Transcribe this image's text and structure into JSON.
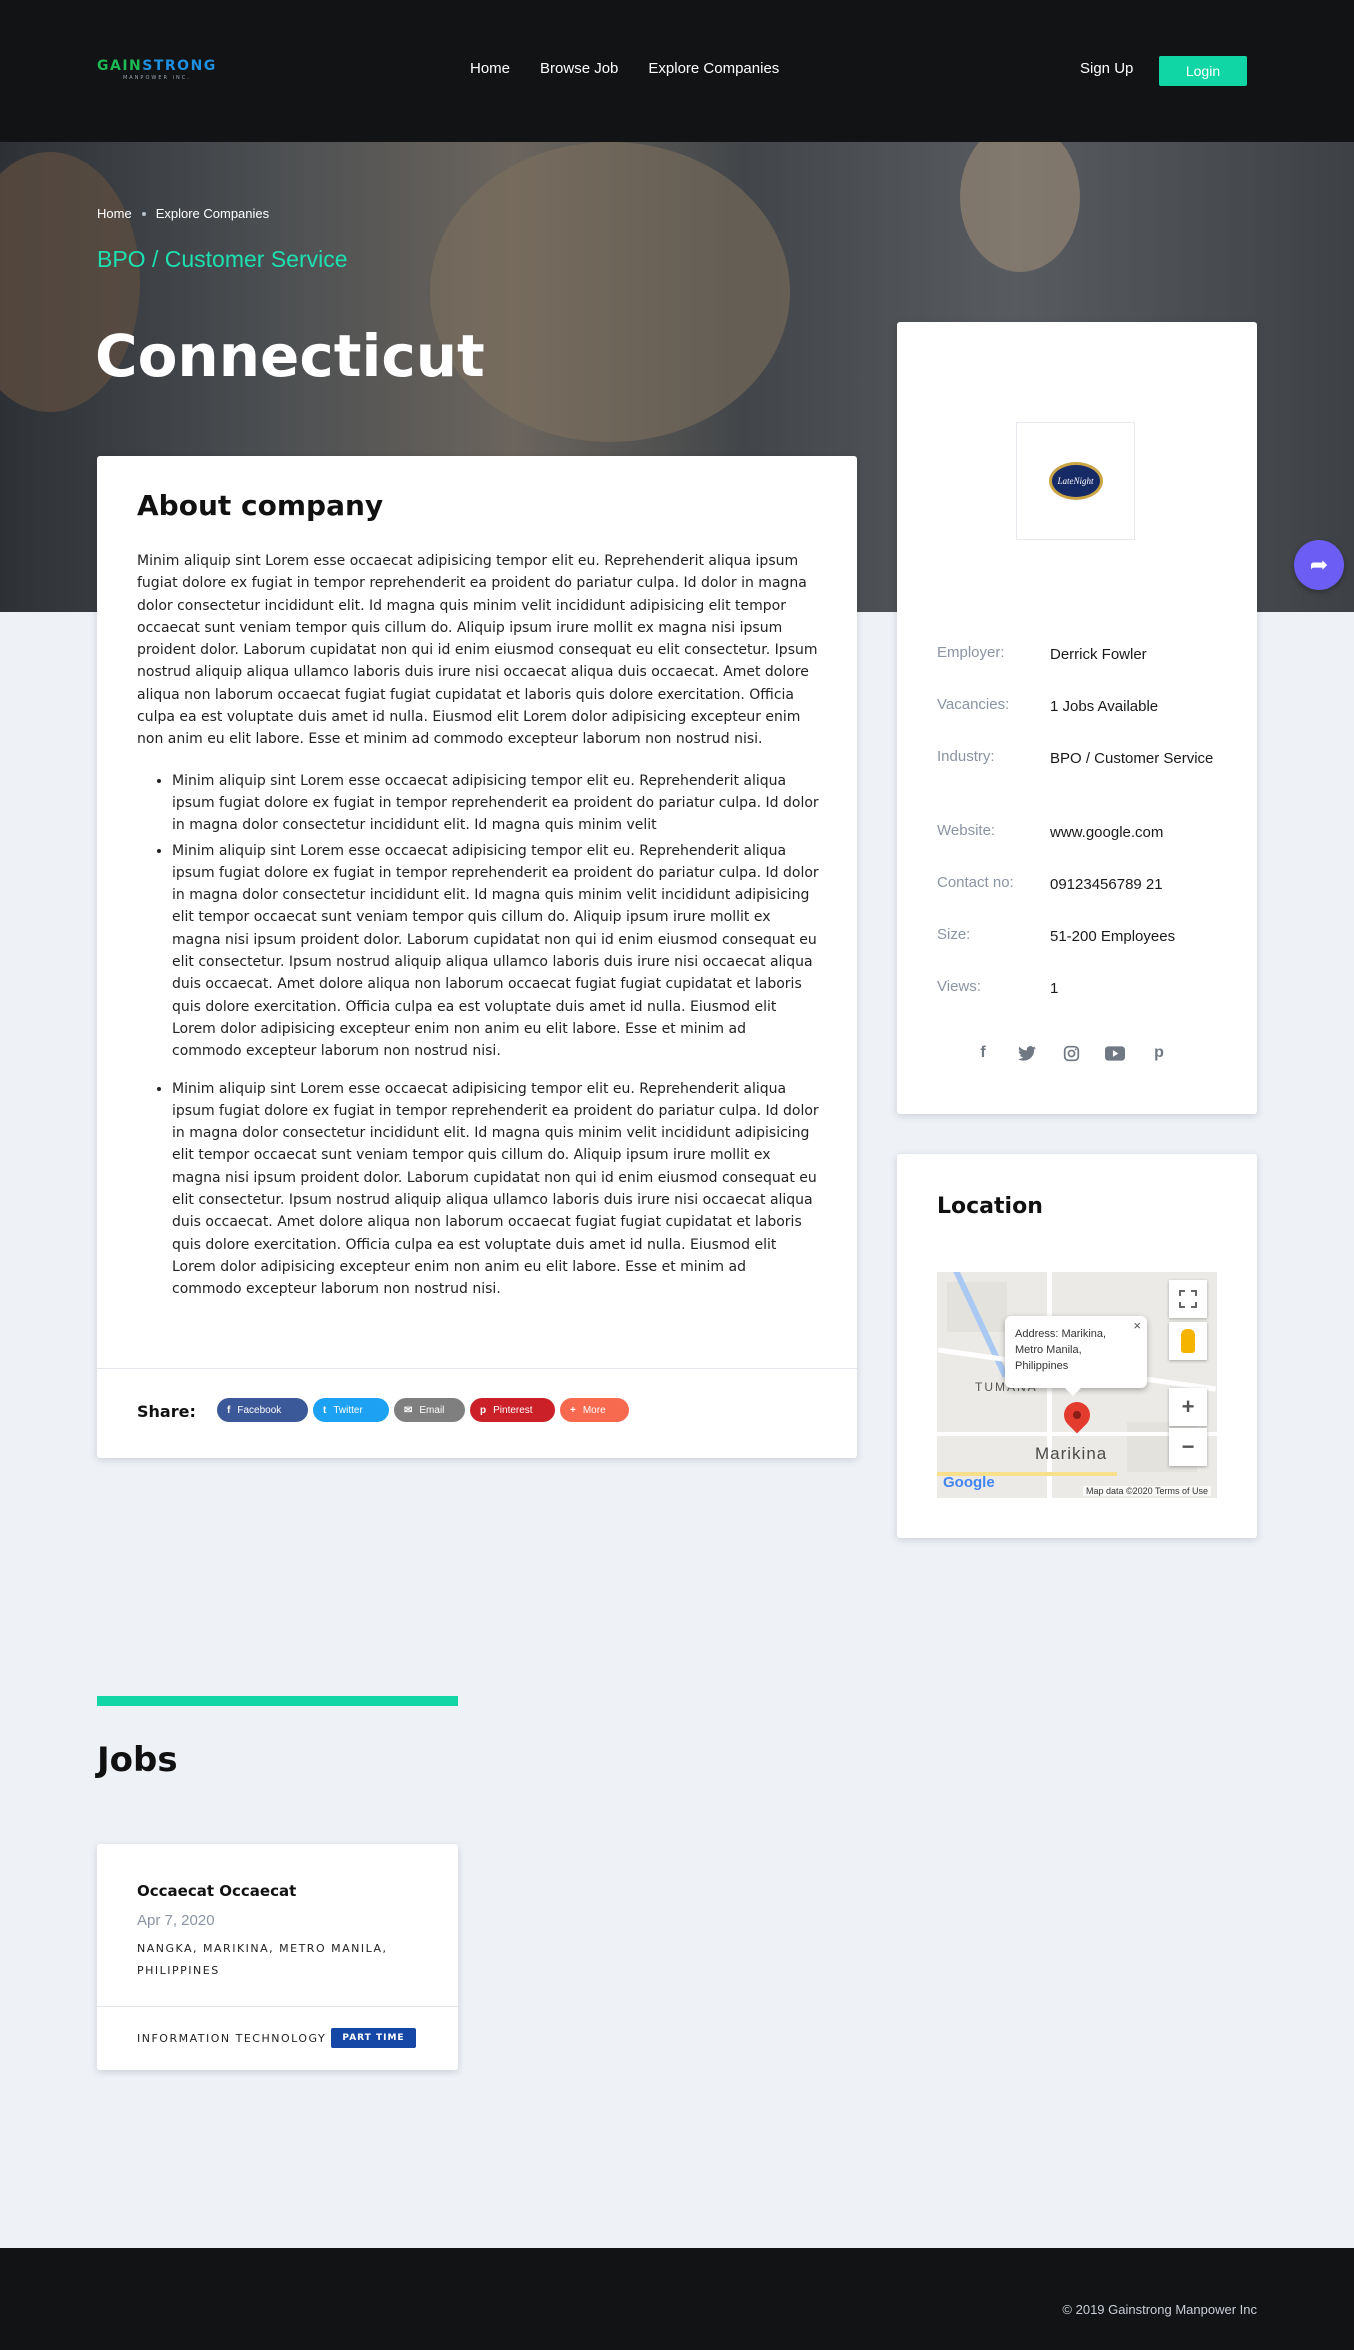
{
  "brand": {
    "logo_part1": "GAIN",
    "logo_part2": "STRONG",
    "logo_sub": "MANPOWER INC."
  },
  "nav": {
    "links": [
      "Home",
      "Browse Job",
      "Explore Companies"
    ],
    "signup": "Sign Up",
    "login": "Login"
  },
  "breadcrumb": [
    "Home",
    "Explore Companies"
  ],
  "hero": {
    "industry": "BPO / Customer Service",
    "company": "Connecticut"
  },
  "about": {
    "title": "About company",
    "paragraph": "Minim aliquip sint Lorem esse occaecat adipisicing tempor elit eu. Reprehenderit aliqua ipsum fugiat dolore ex fugiat in tempor reprehenderit ea proident do pariatur culpa. Id dolor in magna dolor consectetur incididunt elit. Id magna quis minim velit incididunt adipisicing elit tempor occaecat sunt veniam tempor quis cillum do. Aliquip ipsum irure mollit ex magna nisi ipsum proident dolor. Laborum cupidatat non qui id enim eiusmod consequat eu elit consectetur. Ipsum nostrud aliquip aliqua ullamco laboris duis irure nisi occaecat aliqua duis occaecat. Amet dolore aliqua non laborum occaecat fugiat fugiat cupidatat et laboris quis dolore exercitation. Officia culpa ea est voluptate duis amet id nulla. Eiusmod elit Lorem dolor adipisicing excepteur enim non anim eu elit labore. Esse et minim ad commodo excepteur laborum non nostrud nisi.",
    "bullets": [
      "Minim aliquip sint Lorem esse occaecat adipisicing tempor elit eu. Reprehenderit aliqua ipsum fugiat dolore ex fugiat in tempor reprehenderit ea proident do pariatur culpa. Id dolor in magna dolor consectetur incididunt elit. Id magna quis minim velit",
      "Minim aliquip sint Lorem esse occaecat adipisicing tempor elit eu. Reprehenderit aliqua ipsum fugiat dolore ex fugiat in tempor reprehenderit ea proident do pariatur culpa. Id dolor in magna dolor consectetur incididunt elit. Id magna quis minim velit incididunt adipisicing elit tempor occaecat sunt veniam tempor quis cillum do. Aliquip ipsum irure mollit ex magna nisi ipsum proident dolor. Laborum cupidatat non qui id enim eiusmod consequat eu elit consectetur. Ipsum nostrud aliquip aliqua ullamco laboris duis irure nisi occaecat aliqua duis occaecat. Amet dolore aliqua non laborum occaecat fugiat fugiat cupidatat et laboris quis dolore exercitation. Officia culpa ea est voluptate duis amet id nulla. Eiusmod elit Lorem dolor adipisicing excepteur enim non anim eu elit labore. Esse et minim ad commodo excepteur laborum non nostrud nisi.",
      "Minim aliquip sint Lorem esse occaecat adipisicing tempor elit eu. Reprehenderit aliqua ipsum fugiat dolore ex fugiat in tempor reprehenderit ea proident do pariatur culpa. Id dolor in magna dolor consectetur incididunt elit. Id magna quis minim velit incididunt adipisicing elit tempor occaecat sunt veniam tempor quis cillum do. Aliquip ipsum irure mollit ex magna nisi ipsum proident dolor. Laborum cupidatat non qui id enim eiusmod consequat eu elit consectetur. Ipsum nostrud aliquip aliqua ullamco laboris duis irure nisi occaecat aliqua duis occaecat. Amet dolore aliqua non laborum occaecat fugiat fugiat cupidatat et laboris quis dolore exercitation. Officia culpa ea est voluptate duis amet id nulla. Eiusmod elit Lorem dolor adipisicing excepteur enim non anim eu elit labore. Esse et minim ad commodo excepteur laborum non nostrud nisi."
    ]
  },
  "share": {
    "label": "Share:",
    "buttons": [
      {
        "label": "Facebook",
        "icon": "facebook-icon",
        "color": "#3b5998"
      },
      {
        "label": "Twitter",
        "icon": "twitter-icon",
        "color": "#1da1f2"
      },
      {
        "label": "Email",
        "icon": "email-icon",
        "color": "#7f7f7f"
      },
      {
        "label": "Pinterest",
        "icon": "pinterest-icon",
        "color": "#cb2027"
      },
      {
        "label": "More",
        "icon": "plus-icon",
        "color": "#f86a4f"
      }
    ]
  },
  "employer": {
    "logo_text": "LateNight",
    "rows": [
      {
        "label": "Employer:",
        "value": "Derrick Fowler"
      },
      {
        "label": "Vacancies:",
        "value": "1 Jobs Available"
      },
      {
        "label": "Industry:",
        "value": "BPO / Customer Service"
      },
      {
        "label": "Website:",
        "value": "www.google.com"
      },
      {
        "label": "Contact no:",
        "value": "09123456789 21"
      },
      {
        "label": "Size:",
        "value": "51-200 Employees"
      },
      {
        "label": "Views:",
        "value": "1"
      }
    ],
    "socials": [
      "facebook-icon",
      "twitter-icon",
      "instagram-icon",
      "youtube-icon",
      "pinterest-icon"
    ]
  },
  "location": {
    "title": "Location",
    "popup": "Address: Marikina, Metro Manila, Philippines",
    "place": "Marikina",
    "district": "TUMANA",
    "google": "Google",
    "footer": "Map data ©2020   Terms of Use"
  },
  "jobs": {
    "title": "Jobs",
    "items": [
      {
        "title": "Occaecat Occaecat",
        "date": "Apr 7, 2020",
        "location": "NANGKA, MARIKINA, METRO MANILA, PHILIPPINES",
        "category": "INFORMATION TECHNOLOGY",
        "type": "PART TIME"
      }
    ]
  },
  "footer": {
    "copyright": "© 2019 Gainstrong Manpower Inc"
  },
  "colors": {
    "accent": "#0fd6a4",
    "dark": "#121315",
    "job_type": "#1547a6",
    "float_button": "#6c5df5"
  }
}
